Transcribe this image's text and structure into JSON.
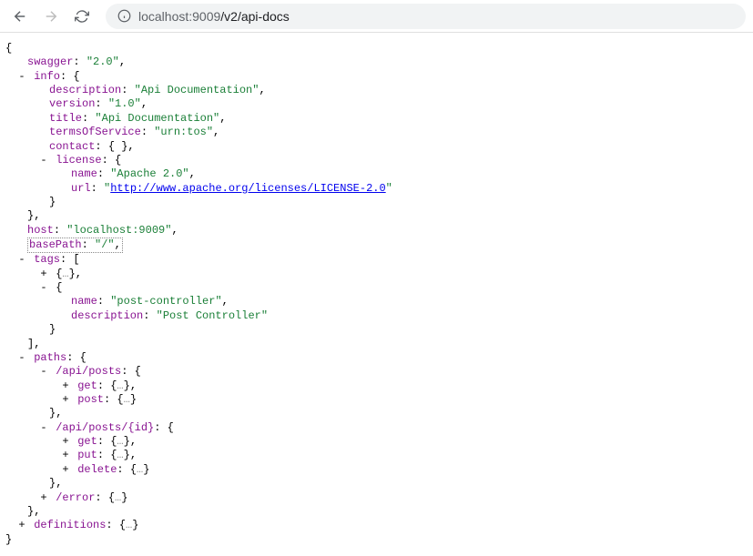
{
  "address": {
    "host": "localhost:9009",
    "path": "/v2/api-docs"
  },
  "json": {
    "swagger_key": "swagger",
    "swagger_val": "\"2.0\"",
    "info_key": "info",
    "description_key": "description",
    "description_val": "\"Api Documentation\"",
    "version_key": "version",
    "version_val": "\"1.0\"",
    "title_key": "title",
    "title_val": "\"Api Documentation\"",
    "terms_key": "termsOfService",
    "terms_val": "\"urn:tos\"",
    "contact_key": "contact",
    "license_key": "license",
    "license_name_key": "name",
    "license_name_val": "\"Apache 2.0\"",
    "license_url_key": "url",
    "license_url_val": "http://www.apache.org/licenses/LICENSE-2.0",
    "host_key": "host",
    "host_val": "\"localhost:9009\"",
    "basepath_key": "basePath",
    "basepath_val": "\"/\"",
    "tags_key": "tags",
    "tag_name_key": "name",
    "tag_name_val": "\"post-controller\"",
    "tag_desc_key": "description",
    "tag_desc_val": "\"Post Controller\"",
    "paths_key": "paths",
    "path1_key": "/api/posts",
    "get_key": "get",
    "post_key": "post",
    "path2_key": "/api/posts/{id}",
    "put_key": "put",
    "delete_key": "delete",
    "path3_key": "/error",
    "definitions_key": "definitions"
  }
}
